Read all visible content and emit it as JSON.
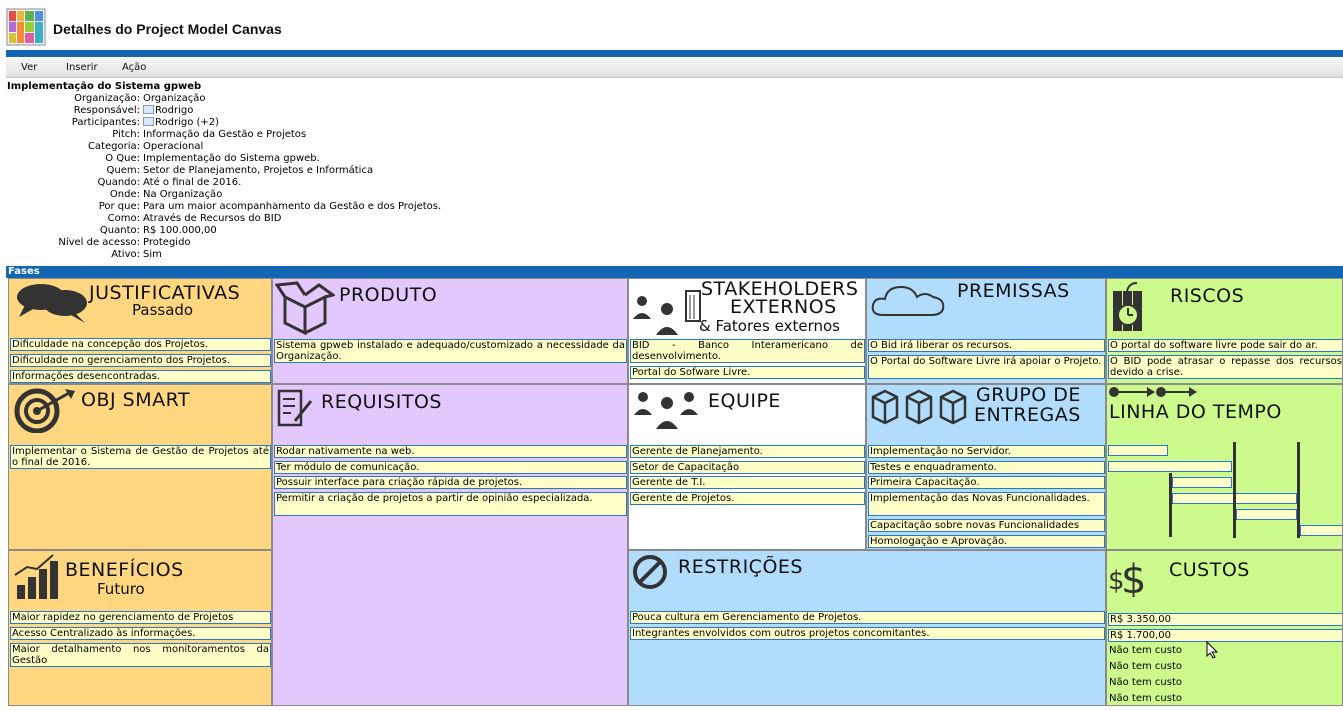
{
  "app": {
    "title": "Detalhes do Project Model Canvas"
  },
  "menu": {
    "items": [
      "Ver",
      "Inserir",
      "Ação"
    ]
  },
  "project": {
    "title": "Implementação do Sistema gpweb",
    "fields": [
      {
        "label": "Organização:",
        "value": "Organização"
      },
      {
        "label": "Responsável:",
        "value": "Rodrigo"
      },
      {
        "label": "Participantes:",
        "value": "Rodrigo (+2)"
      },
      {
        "label": "Pitch:",
        "value": "Informação da Gestão e Projetos"
      },
      {
        "label": "Categoria:",
        "value": "Operacional"
      },
      {
        "label": "O Que:",
        "value": "Implementação do Sistema gpweb."
      },
      {
        "label": "Quem:",
        "value": "Setor de Planejamento, Projetos e Informática"
      },
      {
        "label": "Quando:",
        "value": "Até o final de 2016."
      },
      {
        "label": "Onde:",
        "value": "Na Organização"
      },
      {
        "label": "Por que:",
        "value": "Para um maior acompanhamento da Gestão e dos Projetos."
      },
      {
        "label": "Como:",
        "value": "Através de Recursos do BID"
      },
      {
        "label": "Quanto:",
        "value": "R$ 100.000,00"
      },
      {
        "label": "Nível de acesso:",
        "value": "Protegido"
      },
      {
        "label": "Ativo:",
        "value": "Sim"
      }
    ]
  },
  "phases_label": "Fases",
  "colors": {
    "orange": "#ffd780",
    "purple": "#e3c8fd",
    "blue": "#b1dcfc",
    "green": "#ccfa8c",
    "entry_bg": "#ffffc8",
    "entry_border": "#2a78c4",
    "header_blue": "#1565b5"
  },
  "canvas": {
    "justificativas": {
      "heading": "JUSTIFICATIVAS",
      "sub": "Passado",
      "icon": "speech-bubbles-icon",
      "items": [
        "Dificuldade na concepção dos Projetos.",
        "Dificuldade no gerenciamento dos Projetos.",
        "Informações desencontradas."
      ]
    },
    "obj_smart": {
      "heading": "OBJ SMART",
      "icon": "target-icon",
      "items": [
        "Implementar o Sistema de Gestão de Projetos até o final de 2016."
      ]
    },
    "beneficios": {
      "heading": "BENEFÍCIOS",
      "sub": "Futuro",
      "icon": "growth-chart-icon",
      "items": [
        "Maior rapidez no gerenciamento de Projetos",
        "Acesso Centralizado às informações.",
        "Maior detalhamento nos monitoramentos da Gestão"
      ]
    },
    "produto": {
      "heading": "PRODUTO",
      "icon": "box-icon",
      "items": [
        "Sistema gpweb instalado e adequado/customizado a necessidade da Organização."
      ]
    },
    "requisitos": {
      "heading": "REQUISITOS",
      "icon": "checklist-icon",
      "items": [
        "Rodar nativamente na web.",
        "Ter módulo de comunicação.",
        "Possuir interface para criação rápida de projetos.",
        "Permitir a criação de projetos a partir de opinião especializada."
      ]
    },
    "stakeholders": {
      "heading1": "STAKEHOLDERS",
      "heading2": "EXTERNOS",
      "sub": "& Fatores externos",
      "icon": "people-building-icon",
      "items": [
        "BID - Banco Interamericano de desenvolvimento.",
        "Portal do Sofware Livre."
      ]
    },
    "equipe": {
      "heading": "EQUIPE",
      "icon": "team-icon",
      "items": [
        "Gerente de Planejamento.",
        "Setor de Capacitação",
        "Gerente de T.I.",
        "Gerente de Projetos."
      ]
    },
    "restricoes": {
      "heading": "RESTRIÇÕES",
      "icon": "prohibited-icon",
      "items": [
        "Pouca cultura em Gerenciamento de Projetos.",
        "Integrantes  envolvidos com outros projetos concomitantes."
      ]
    },
    "premissas": {
      "heading": "PREMISSAS",
      "icon": "cloud-icon",
      "items": [
        "O Bid irá liberar os recursos.",
        "O Portal do Software Livre irá apoiar o Projeto."
      ]
    },
    "entregas": {
      "heading1": "GRUPO DE",
      "heading2": "ENTREGAS",
      "icon": "packages-icon",
      "items": [
        "Implementação no Servidor.",
        "Testes e enquadramento.",
        "Primeira Capacitação.",
        "Implementação das Novas Funcionalidades.",
        "Capacitação sobre novas Funcionalidades",
        "Homologação e Aprovação."
      ]
    },
    "riscos": {
      "heading": "RISCOS",
      "icon": "dynamite-icon",
      "items": [
        "O portal do software livre pode sair do ar.",
        "O BID pode atrasar o repasse dos recursos devido a crise."
      ]
    },
    "linha_tempo": {
      "heading": "LINHA DO TEMPO",
      "icon": "timeline-arrows-icon"
    },
    "custos": {
      "heading": "CUSTOS",
      "icon": "dollar-icon",
      "items": [
        "R$ 3.350,00",
        "R$ 1.700,00"
      ],
      "plain_items": [
        "Não tem custo",
        "Não tem custo",
        "Não tem custo",
        "Não tem custo"
      ]
    }
  }
}
